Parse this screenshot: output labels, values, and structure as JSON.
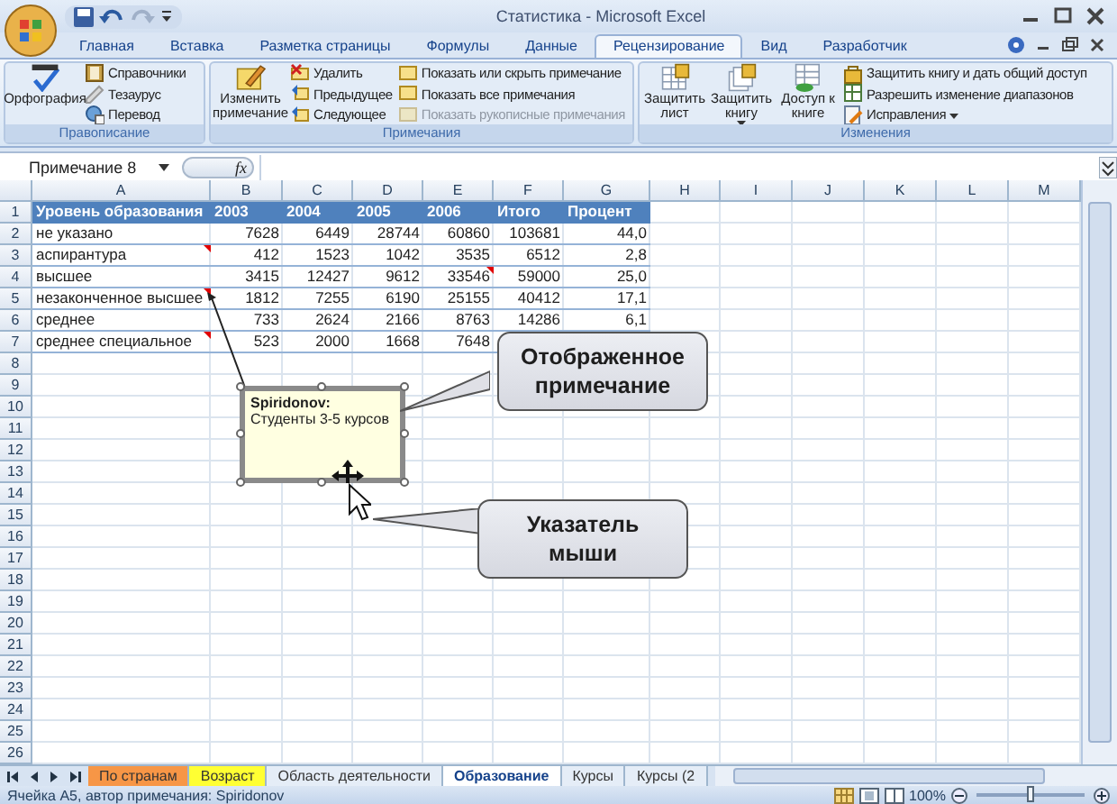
{
  "window": {
    "title": "Статистика - Microsoft Excel"
  },
  "ribbon": {
    "tabs": [
      {
        "label": "Главная",
        "selected": false
      },
      {
        "label": "Вставка",
        "selected": false
      },
      {
        "label": "Разметка страницы",
        "selected": false
      },
      {
        "label": "Формулы",
        "selected": false
      },
      {
        "label": "Данные",
        "selected": false
      },
      {
        "label": "Рецензирование",
        "selected": true
      },
      {
        "label": "Вид",
        "selected": false
      },
      {
        "label": "Разработчик",
        "selected": false
      }
    ],
    "groups": [
      {
        "title": "Правописание",
        "large": [
          {
            "label": "Орфография",
            "dropdown": false
          }
        ],
        "columns": [
          [
            {
              "label": "Справочники",
              "disabled": false
            },
            {
              "label": "Тезаурус",
              "disabled": false
            },
            {
              "label": "Перевод",
              "disabled": false
            }
          ]
        ]
      },
      {
        "title": "Примечания",
        "large": [
          {
            "label": "Изменить примечание",
            "dropdown": false
          }
        ],
        "columns": [
          [
            {
              "label": "Удалить",
              "disabled": false
            },
            {
              "label": "Предыдущее",
              "disabled": false
            },
            {
              "label": "Следующее",
              "disabled": false
            }
          ],
          [
            {
              "label": "Показать или скрыть примечание",
              "disabled": false
            },
            {
              "label": "Показать все примечания",
              "disabled": false
            },
            {
              "label": "Показать рукописные примечания",
              "disabled": true
            }
          ]
        ]
      },
      {
        "title": "Изменения",
        "large": [
          {
            "label": "Защитить лист",
            "dropdown": false
          },
          {
            "label": "Защитить книгу",
            "dropdown": true
          },
          {
            "label": "Доступ к книге",
            "dropdown": false
          }
        ],
        "columns": [
          [
            {
              "label": "Защитить книгу и дать общий доступ",
              "disabled": false
            },
            {
              "label": "Разрешить изменение диапазонов",
              "disabled": false
            },
            {
              "label": "Исправления",
              "disabled": false,
              "dropdown": true
            }
          ]
        ]
      }
    ]
  },
  "formula_bar": {
    "name_box": "Примечание 8",
    "function_label": "fx"
  },
  "sheet": {
    "columns": [
      "A",
      "B",
      "C",
      "D",
      "E",
      "F",
      "G",
      "H",
      "I",
      "J",
      "K",
      "L",
      "M"
    ],
    "row_numbers": [
      "1",
      "2",
      "3",
      "4",
      "5",
      "6",
      "7",
      "8",
      "9",
      "10",
      "11",
      "12",
      "13",
      "14",
      "15",
      "16",
      "17",
      "18",
      "19",
      "20",
      "21",
      "22",
      "23",
      "24",
      "25",
      "26"
    ],
    "header": [
      "Уровень образования",
      "2003",
      "2004",
      "2005",
      "2006",
      "Итого",
      "Процент"
    ],
    "rows": [
      {
        "cells": [
          {
            "text": "не указано",
            "comment": false
          },
          {
            "text": "7628",
            "comment": false
          },
          {
            "text": "6449",
            "comment": false
          },
          {
            "text": "28744",
            "comment": false
          },
          {
            "text": "60860",
            "comment": false
          },
          {
            "text": "103681",
            "comment": false
          },
          {
            "text": "44,0",
            "comment": false
          }
        ]
      },
      {
        "cells": [
          {
            "text": "аспирантура",
            "comment": true
          },
          {
            "text": "412",
            "comment": false
          },
          {
            "text": "1523",
            "comment": false
          },
          {
            "text": "1042",
            "comment": false
          },
          {
            "text": "3535",
            "comment": false
          },
          {
            "text": "6512",
            "comment": false
          },
          {
            "text": "2,8",
            "comment": false
          }
        ]
      },
      {
        "cells": [
          {
            "text": "высшее",
            "comment": false
          },
          {
            "text": "3415",
            "comment": false
          },
          {
            "text": "12427",
            "comment": false
          },
          {
            "text": "9612",
            "comment": false
          },
          {
            "text": "33546",
            "comment": true
          },
          {
            "text": "59000",
            "comment": false
          },
          {
            "text": "25,0",
            "comment": false
          }
        ]
      },
      {
        "cells": [
          {
            "text": "незаконченное высшее",
            "comment": true
          },
          {
            "text": "1812",
            "comment": false
          },
          {
            "text": "7255",
            "comment": false
          },
          {
            "text": "6190",
            "comment": false
          },
          {
            "text": "25155",
            "comment": false
          },
          {
            "text": "40412",
            "comment": false
          },
          {
            "text": "17,1",
            "comment": false
          }
        ]
      },
      {
        "cells": [
          {
            "text": "среднее",
            "comment": false
          },
          {
            "text": "733",
            "comment": false
          },
          {
            "text": "2624",
            "comment": false
          },
          {
            "text": "2166",
            "comment": false
          },
          {
            "text": "8763",
            "comment": false
          },
          {
            "text": "14286",
            "comment": false
          },
          {
            "text": "6,1",
            "comment": false
          }
        ]
      },
      {
        "cells": [
          {
            "text": "среднее специальное",
            "comment": true
          },
          {
            "text": "523",
            "comment": false
          },
          {
            "text": "2000",
            "comment": false
          },
          {
            "text": "1668",
            "comment": false
          },
          {
            "text": "7648",
            "comment": false
          }
        ]
      }
    ],
    "comment": {
      "author": "Spiridonov:",
      "text": "Студенты 3-5 курсов"
    },
    "callouts": [
      {
        "text": "Отображенное примечание"
      },
      {
        "text": "Указатель мыши"
      }
    ]
  },
  "sheet_tabs": [
    {
      "label": "По странам",
      "selected": false,
      "color": "#f79646"
    },
    {
      "label": "Возраст",
      "selected": false,
      "color": "#ffff33"
    },
    {
      "label": "Область деятельности",
      "selected": false
    },
    {
      "label": "Образование",
      "selected": true
    },
    {
      "label": "Курсы",
      "selected": false
    },
    {
      "label": "Курсы (2",
      "selected": false
    }
  ],
  "status_bar": {
    "text": "Ячейка A5, автор примечания: Spiridonov",
    "zoom": "100%",
    "zoom_slider": {
      "level": 0.5
    }
  }
}
